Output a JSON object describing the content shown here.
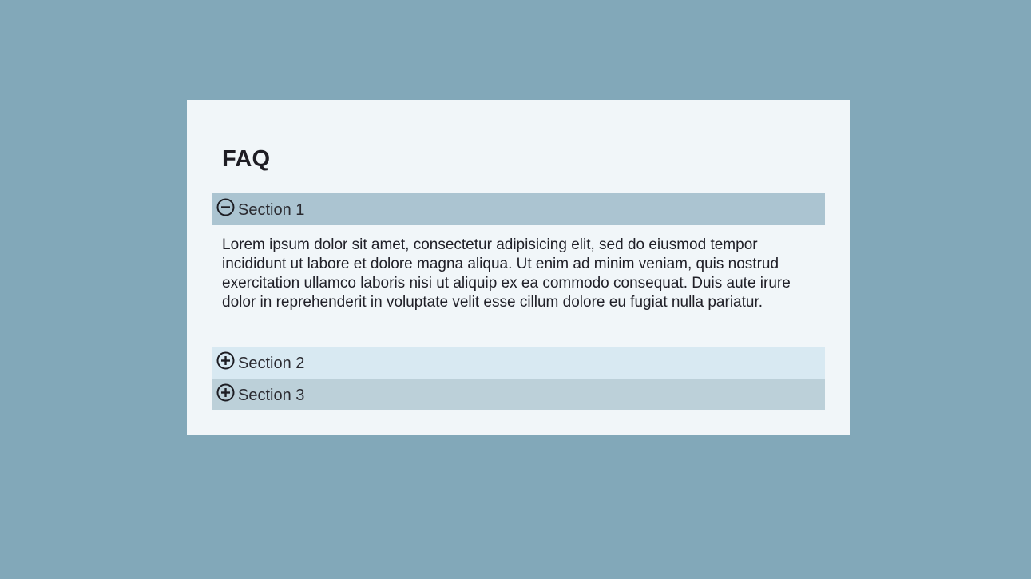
{
  "faq": {
    "title": "FAQ",
    "sections": [
      {
        "label": "Section 1",
        "expanded": true,
        "icon": "minus-circle-icon",
        "body": "Lorem ipsum dolor sit amet, consectetur adipisicing elit, sed do eiusmod tempor incididunt ut labore et dolore magna aliqua. Ut enim ad minim veniam, quis nostrud exercitation ullamco laboris nisi ut aliquip ex ea commodo consequat. Duis aute irure dolor in reprehenderit in voluptate velit esse cillum dolore eu fugiat nulla pariatur."
      },
      {
        "label": "Section 2",
        "expanded": false,
        "icon": "plus-circle-icon"
      },
      {
        "label": "Section 3",
        "expanded": false,
        "icon": "plus-circle-icon"
      }
    ]
  },
  "colors": {
    "page_background": "#82a8b9",
    "card_background": "#f1f6f9",
    "section_1_header": "#abc4d1",
    "section_2_header": "#d8e9f2",
    "section_3_header": "#bcd0d9"
  }
}
